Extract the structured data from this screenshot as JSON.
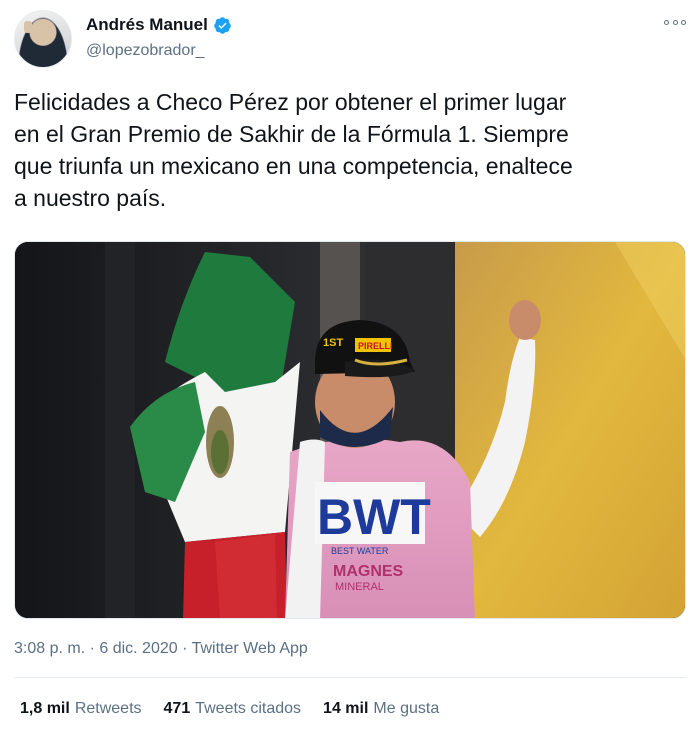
{
  "author": {
    "name": "Andrés Manuel",
    "handle": "@lopezobrador_"
  },
  "tweet": {
    "text": "Felicidades a Checo Pérez por obtener el primer lugar\nen el Gran Premio de Sakhir de la Fórmula 1. Siempre\nque triunfa un mexicano en una competencia, enaltece\na nuestro país."
  },
  "media": {
    "image": "photo-racer-with-mexican-flag",
    "cap_badge": "1ST",
    "cap_brand": "PIRELLI",
    "suit_logo": "BWT",
    "suit_text_1": "BEST WATER",
    "suit_text_2": "MAGNES",
    "suit_text_3": "MINERAL"
  },
  "meta": {
    "timestamp": "3:08 p. m. · 6 dic. 2020 · Twitter Web App"
  },
  "stats": {
    "retweets_count": "1,8 mil",
    "retweets_label": "Retweets",
    "quotes_count": "471",
    "quotes_label": "Tweets citados",
    "likes_count": "14 mil",
    "likes_label": "Me gusta"
  },
  "colors": {
    "verified": "#1da1f2",
    "secondary_text": "#5b7083"
  }
}
